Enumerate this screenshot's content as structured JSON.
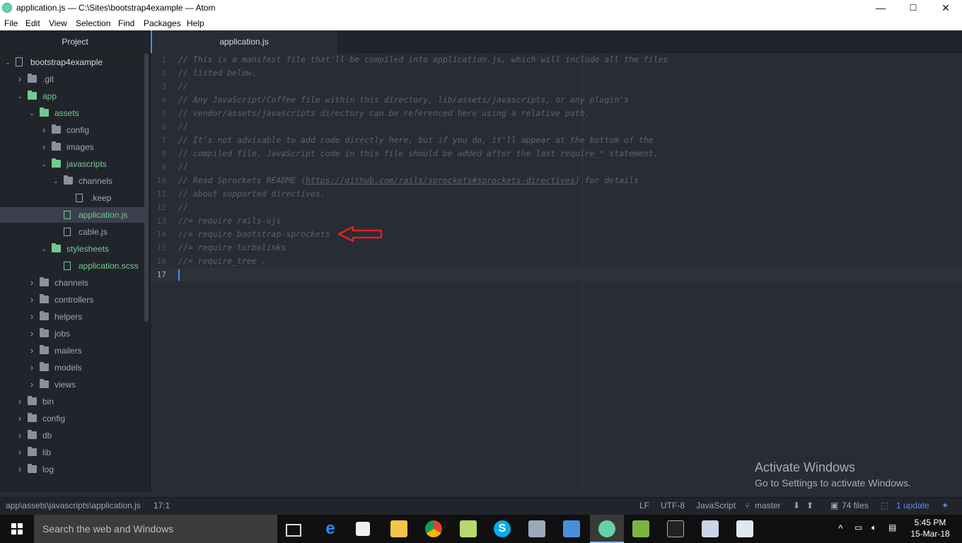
{
  "window": {
    "title": "application.js — C:\\Sites\\bootstrap4example — Atom",
    "controls": {
      "minimize": "—",
      "maximize": "☐",
      "close": "✕"
    }
  },
  "menu": [
    "File",
    "Edit",
    "View",
    "Selection",
    "Find",
    "Packages",
    "Help"
  ],
  "tree": {
    "header": "Project",
    "items": [
      {
        "label": "bootstrap4example",
        "depth": 0,
        "kind": "repo",
        "expanded": true
      },
      {
        "label": ".git",
        "depth": 1,
        "kind": "folder",
        "expanded": false
      },
      {
        "label": "app",
        "depth": 1,
        "kind": "folder",
        "expanded": true,
        "green": true
      },
      {
        "label": "assets",
        "depth": 2,
        "kind": "folder",
        "expanded": true,
        "green": true
      },
      {
        "label": "config",
        "depth": 3,
        "kind": "folder",
        "expanded": false
      },
      {
        "label": "images",
        "depth": 3,
        "kind": "folder",
        "expanded": false
      },
      {
        "label": "javascripts",
        "depth": 3,
        "kind": "folder",
        "expanded": true,
        "green": true
      },
      {
        "label": "channels",
        "depth": 4,
        "kind": "folder",
        "expanded": true
      },
      {
        "label": ".keep",
        "depth": 5,
        "kind": "file"
      },
      {
        "label": "application.js",
        "depth": 4,
        "kind": "file",
        "green": true,
        "selected": true
      },
      {
        "label": "cable.js",
        "depth": 4,
        "kind": "file"
      },
      {
        "label": "stylesheets",
        "depth": 3,
        "kind": "folder",
        "expanded": true,
        "green": true
      },
      {
        "label": "application.scss",
        "depth": 4,
        "kind": "file",
        "green": true
      },
      {
        "label": "channels",
        "depth": 2,
        "kind": "folder",
        "expanded": false
      },
      {
        "label": "controllers",
        "depth": 2,
        "kind": "folder",
        "expanded": false
      },
      {
        "label": "helpers",
        "depth": 2,
        "kind": "folder",
        "expanded": false
      },
      {
        "label": "jobs",
        "depth": 2,
        "kind": "folder",
        "expanded": false
      },
      {
        "label": "mailers",
        "depth": 2,
        "kind": "folder",
        "expanded": false
      },
      {
        "label": "models",
        "depth": 2,
        "kind": "folder",
        "expanded": false
      },
      {
        "label": "views",
        "depth": 2,
        "kind": "folder",
        "expanded": false
      },
      {
        "label": "bin",
        "depth": 1,
        "kind": "folder",
        "expanded": false
      },
      {
        "label": "config",
        "depth": 1,
        "kind": "folder",
        "expanded": false
      },
      {
        "label": "db",
        "depth": 1,
        "kind": "folder",
        "expanded": false
      },
      {
        "label": "lib",
        "depth": 1,
        "kind": "folder",
        "expanded": false
      },
      {
        "label": "log",
        "depth": 1,
        "kind": "folder",
        "expanded": false
      }
    ]
  },
  "tab": {
    "label": "application.js"
  },
  "editor": {
    "lines": [
      "// This is a manifest file that'll be compiled into application.js, which will include all the files",
      "// listed below.",
      "//",
      "// Any JavaScript/Coffee file within this directory, lib/assets/javascripts, or any plugin's",
      "// vendor/assets/javascripts directory can be referenced here using a relative path.",
      "//",
      "// It's not advisable to add code directly here, but if you do, it'll appear at the bottom of the",
      "// compiled file. JavaScript code in this file should be added after the last require_* statement.",
      "//",
      "// Read Sprockets README (https://github.com/rails/sprockets#sprockets-directives) for details",
      "// about supported directives.",
      "//",
      "//= require rails-ujs",
      "//= require bootstrap-sprockets",
      "//= require turbolinks",
      "//= require_tree .",
      ""
    ],
    "link_text": "https://github.com/rails/sprockets#sprockets-directives",
    "cursor_line": 17,
    "annotation_line": 14,
    "annotation_color": "#e02020"
  },
  "watermark": {
    "line1": "Activate Windows",
    "line2": "Go to Settings to activate Windows."
  },
  "status": {
    "path": "app\\assets\\javascripts\\application.js",
    "position": "17:1",
    "line_ending": "LF",
    "encoding": "UTF-8",
    "grammar": "JavaScript",
    "branch": "master",
    "files": "74 files",
    "update": "1 update"
  },
  "taskbar": {
    "search_placeholder": "Search the web and Windows",
    "time": "5:45 PM",
    "date": "15-Mar-18"
  }
}
